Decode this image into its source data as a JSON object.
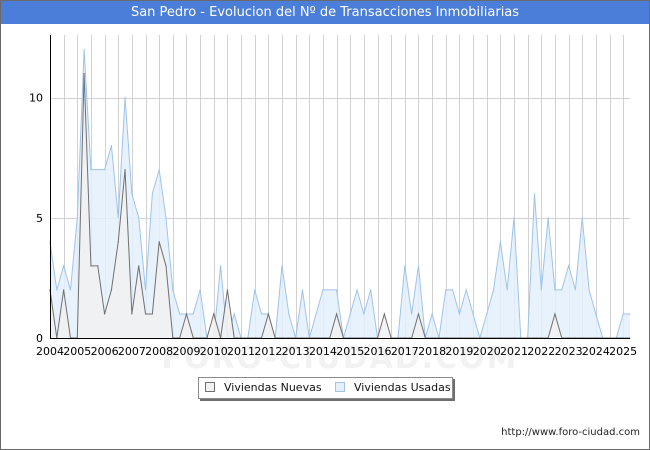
{
  "title": "San Pedro - Evolucion del Nº de Transacciones Inmobiliarias",
  "footer_url": "http://www.foro-ciudad.com",
  "watermark": "FORO-CIUDAD.COM",
  "colors": {
    "title_bg": "#4a7ed8",
    "nuevas_fill": "#f1f1f1",
    "nuevas_line": "#707070",
    "usadas_fill": "#e4f0fb",
    "usadas_line": "#9fc3ea",
    "grid": "#d2d2d2"
  },
  "chart_data": {
    "type": "area",
    "title": "San Pedro - Evolucion del Nº de Transacciones Inmobiliarias",
    "xlabel": "",
    "ylabel": "",
    "x_tick_labels": [
      "2004",
      "2005",
      "2006",
      "2007",
      "2008",
      "2009",
      "2010",
      "2011",
      "2012",
      "2013",
      "2014",
      "2015",
      "2016",
      "2017",
      "2018",
      "2019",
      "2020",
      "2021",
      "2022",
      "2023",
      "2024",
      "2025"
    ],
    "x_range": [
      2004,
      2025.25
    ],
    "ylim": [
      0,
      12.6
    ],
    "y_ticks": [
      0,
      5,
      10
    ],
    "grid": true,
    "legend_position": "bottom",
    "series": [
      {
        "name": "Viviendas Nuevas",
        "x": [
          2004,
          2004.25,
          2004.5,
          2004.75,
          2005,
          2005.25,
          2005.5,
          2005.75,
          2006,
          2006.25,
          2006.5,
          2006.75,
          2007,
          2007.25,
          2007.5,
          2007.75,
          2008,
          2008.25,
          2008.5,
          2008.75,
          2009,
          2009.25,
          2009.5,
          2009.75,
          2010,
          2010.25,
          2010.5,
          2010.75,
          2011,
          2011.25,
          2011.5,
          2011.75,
          2012,
          2012.25,
          2012.5,
          2012.75,
          2013,
          2013.25,
          2013.5,
          2013.75,
          2014,
          2014.25,
          2014.5,
          2014.75,
          2015,
          2015.25,
          2015.5,
          2015.75,
          2016,
          2016.25,
          2016.5,
          2016.75,
          2017,
          2017.25,
          2017.5,
          2017.75,
          2018,
          2018.25,
          2018.5,
          2018.75,
          2019,
          2019.25,
          2019.5,
          2019.75,
          2020,
          2020.25,
          2020.5,
          2020.75,
          2021,
          2021.25,
          2021.5,
          2021.75,
          2022,
          2022.25,
          2022.5,
          2022.75,
          2023,
          2023.25,
          2023.5,
          2023.75,
          2024,
          2024.25,
          2024.5,
          2024.75,
          2025,
          2025.25
        ],
        "values": [
          2,
          0,
          2,
          0,
          0,
          11,
          3,
          3,
          1,
          2,
          4,
          7,
          1,
          3,
          1,
          1,
          4,
          3,
          0,
          0,
          1,
          0,
          0,
          0,
          1,
          0,
          2,
          0,
          0,
          0,
          0,
          0,
          1,
          0,
          0,
          0,
          0,
          0,
          0,
          0,
          0,
          0,
          1,
          0,
          0,
          0,
          0,
          0,
          0,
          1,
          0,
          0,
          0,
          0,
          1,
          0,
          0,
          0,
          0,
          0,
          0,
          0,
          0,
          0,
          0,
          0,
          0,
          0,
          0,
          0,
          0,
          0,
          0,
          0,
          1,
          0,
          0,
          0,
          0,
          0,
          0,
          0,
          0,
          0,
          0,
          0
        ]
      },
      {
        "name": "Viviendas Usadas",
        "x": [
          2004,
          2004.25,
          2004.5,
          2004.75,
          2005,
          2005.25,
          2005.5,
          2005.75,
          2006,
          2006.25,
          2006.5,
          2006.75,
          2007,
          2007.25,
          2007.5,
          2007.75,
          2008,
          2008.25,
          2008.5,
          2008.75,
          2009,
          2009.25,
          2009.5,
          2009.75,
          2010,
          2010.25,
          2010.5,
          2010.75,
          2011,
          2011.25,
          2011.5,
          2011.75,
          2012,
          2012.25,
          2012.5,
          2012.75,
          2013,
          2013.25,
          2013.5,
          2013.75,
          2014,
          2014.25,
          2014.5,
          2014.75,
          2015,
          2015.25,
          2015.5,
          2015.75,
          2016,
          2016.25,
          2016.5,
          2016.75,
          2017,
          2017.25,
          2017.5,
          2017.75,
          2018,
          2018.25,
          2018.5,
          2018.75,
          2019,
          2019.25,
          2019.5,
          2019.75,
          2020,
          2020.25,
          2020.5,
          2020.75,
          2021,
          2021.25,
          2021.5,
          2021.75,
          2022,
          2022.25,
          2022.5,
          2022.75,
          2023,
          2023.25,
          2023.5,
          2023.75,
          2024,
          2024.25,
          2024.5,
          2024.75,
          2025,
          2025.25
        ],
        "values": [
          4,
          2,
          3,
          2,
          5,
          12,
          7,
          7,
          7,
          8,
          5,
          10,
          6,
          5,
          2,
          6,
          7,
          5,
          2,
          1,
          1,
          1,
          2,
          0,
          0,
          3,
          0,
          1,
          0,
          0,
          2,
          1,
          1,
          0,
          3,
          1,
          0,
          2,
          0,
          1,
          2,
          2,
          2,
          0,
          1,
          2,
          1,
          2,
          0,
          0,
          0,
          0,
          3,
          1,
          3,
          0,
          1,
          0,
          2,
          2,
          1,
          2,
          1,
          0,
          1,
          2,
          4,
          2,
          5,
          0,
          0,
          6,
          2,
          5,
          2,
          2,
          3,
          2,
          5,
          2,
          1,
          0,
          0,
          0,
          1,
          1
        ]
      }
    ]
  }
}
